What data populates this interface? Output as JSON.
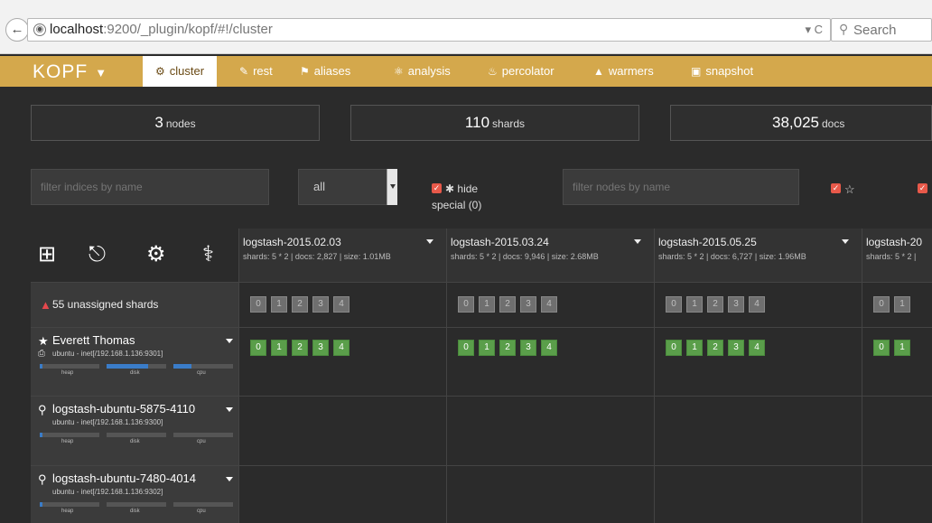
{
  "browser": {
    "url_host": "localhost",
    "url_tail": ":9200/_plugin/kopf/#!/cluster",
    "url_right": "▾ C",
    "search_placeholder": "Search"
  },
  "nav": {
    "brand": "KOPF",
    "items": [
      {
        "label": "cluster",
        "icon": "sitemap-icon",
        "active": true
      },
      {
        "label": "rest",
        "icon": "edit-icon"
      },
      {
        "label": "aliases",
        "icon": "tag-icon"
      },
      {
        "label": "analysis",
        "icon": "tree-icon"
      },
      {
        "label": "percolator",
        "icon": "bell-icon"
      },
      {
        "label": "warmers",
        "icon": "fire-icon"
      },
      {
        "label": "snapshot",
        "icon": "camera-icon"
      }
    ],
    "accent": "#d4a84c"
  },
  "summary": {
    "nodes": {
      "value": "3",
      "unit": "nodes"
    },
    "shards": {
      "value": "110",
      "unit": "shards"
    },
    "docs": {
      "value": "38,025",
      "unit": "docs"
    }
  },
  "filters": {
    "indices_placeholder": "filter indices by name",
    "select_value": "all",
    "hide_special_label": "hide",
    "hide_special_sub": "special (0)",
    "nodes_placeholder": "filter nodes by name"
  },
  "toolbar": {
    "icons": [
      "add-index-icon",
      "unlock-icon",
      "gear-icon",
      "stethoscope-icon"
    ]
  },
  "indices": [
    {
      "name": "logstash-2015.02.03",
      "stats": "shards: 5 * 2 | docs: 2,827 | size: 1.01MB"
    },
    {
      "name": "logstash-2015.03.24",
      "stats": "shards: 5 * 2 | docs: 9,946 | size: 2.68MB"
    },
    {
      "name": "logstash-2015.05.25",
      "stats": "shards: 5 * 2 | docs: 6,727 | size: 1.96MB"
    },
    {
      "name": "logstash-20",
      "stats": "shards: 5 * 2 |"
    }
  ],
  "unassigned": {
    "label": "55 unassigned shards"
  },
  "shard_numbers": [
    "0",
    "1",
    "2",
    "3",
    "4"
  ],
  "nodes": [
    {
      "name": "Everett Thomas",
      "icon": "star-icon",
      "addr": "ubuntu - inet[/192.168.1.136:9301]",
      "heap": 0.05,
      "disk": 0.7,
      "cpu": 0.3
    },
    {
      "name": "logstash-ubuntu-5875-4110",
      "icon": "search-icon",
      "addr": "ubuntu - inet[/192.168.1.136:9300]",
      "heap": 0.05,
      "disk": 0.0,
      "cpu": 0.0
    },
    {
      "name": "logstash-ubuntu-7480-4014",
      "icon": "search-icon",
      "addr": "ubuntu - inet[/192.168.1.136:9302]",
      "heap": 0.05,
      "disk": 0.0,
      "cpu": 0.0
    }
  ],
  "bar_labels": [
    "heap",
    "disk",
    "cpu"
  ]
}
